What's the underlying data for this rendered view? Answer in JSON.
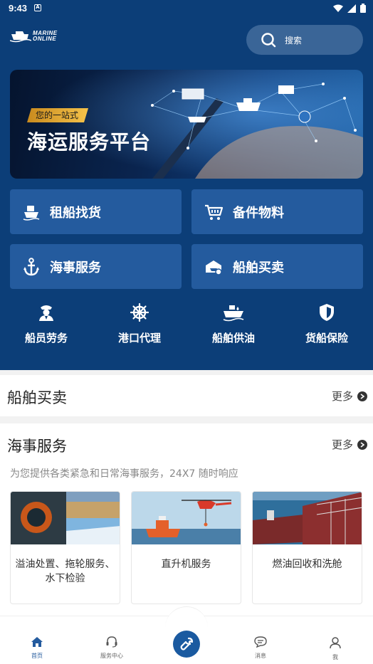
{
  "status": {
    "time": "9:43",
    "notif_letter": "A"
  },
  "brand": {
    "line1": "MARINE",
    "line2": "ONLINE"
  },
  "search": {
    "placeholder": "搜索"
  },
  "banner": {
    "tag": "您的一站式",
    "title": "海运服务平台"
  },
  "main_services": [
    {
      "label": "租船找货",
      "icon": "ship-cargo-icon"
    },
    {
      "label": "备件物料",
      "icon": "cart-icon"
    },
    {
      "label": "海事服务",
      "icon": "anchor-icon"
    },
    {
      "label": "船舶买卖",
      "icon": "ship-trade-icon"
    }
  ],
  "sub_services": [
    {
      "label": "船员劳务",
      "icon": "captain-icon"
    },
    {
      "label": "港口代理",
      "icon": "helm-icon"
    },
    {
      "label": "船舶供油",
      "icon": "tanker-icon"
    },
    {
      "label": "货船保险",
      "icon": "shield-icon"
    }
  ],
  "section_trade": {
    "title": "船舶买卖",
    "more": "更多"
  },
  "section_maritime": {
    "title": "海事服务",
    "more": "更多",
    "subtitle": "为您提供各类紧急和日常海事服务，24X7 随时响应",
    "cards": [
      {
        "label": "溢油处置、拖轮服务、水下检验"
      },
      {
        "label": "直升机服务"
      },
      {
        "label": "燃油回收和洗舱"
      }
    ]
  },
  "bottom_nav": [
    {
      "label": "首页",
      "icon": "home-icon",
      "active": true
    },
    {
      "label": "服务中心",
      "icon": "headset-icon"
    },
    {
      "label": "",
      "icon": "wrench-icon"
    },
    {
      "label": "消息",
      "icon": "chat-icon"
    },
    {
      "label": "我",
      "icon": "user-icon"
    }
  ],
  "colors": {
    "primary": "#0c3e78",
    "button": "#245b9e",
    "accent": "#f5c24a"
  }
}
